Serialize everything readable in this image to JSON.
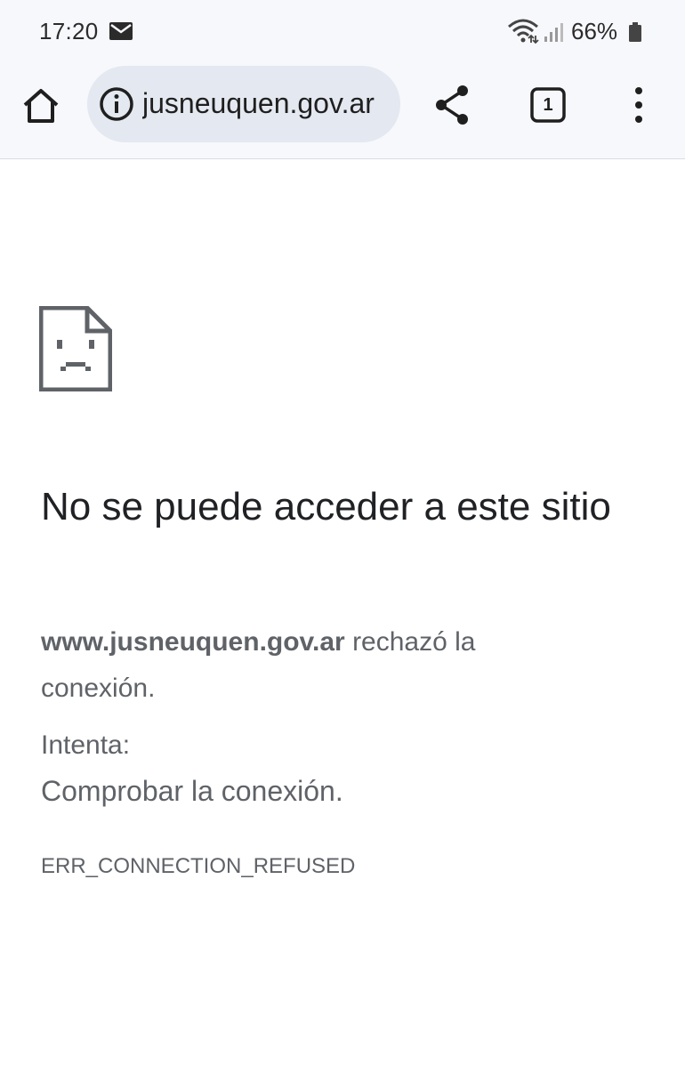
{
  "status_bar": {
    "time": "17:20",
    "battery": "66%",
    "icons": [
      "mail-icon",
      "wifi-icon",
      "signal-icon",
      "battery-icon"
    ]
  },
  "toolbar": {
    "url": "jusneuquen.gov.ar",
    "tab_count": "1",
    "icons": [
      "home-icon",
      "info-icon",
      "share-icon",
      "tabs-icon",
      "more-vert-icon"
    ]
  },
  "error": {
    "icon": "sad-page-icon",
    "title": "No se puede acceder a este sitio",
    "host": "www.jusneuquen.gov.ar",
    "message": "rechazó la conexión.",
    "try_label": "Intenta:",
    "try_item": "Comprobar la conexión.",
    "code": "ERR_CONNECTION_REFUSED"
  },
  "colors": {
    "toolbar_bg": "#f7f8fc",
    "omnibox_bg": "#e4e8f0",
    "text_secondary": "#5f6368",
    "text_primary": "#202124"
  }
}
